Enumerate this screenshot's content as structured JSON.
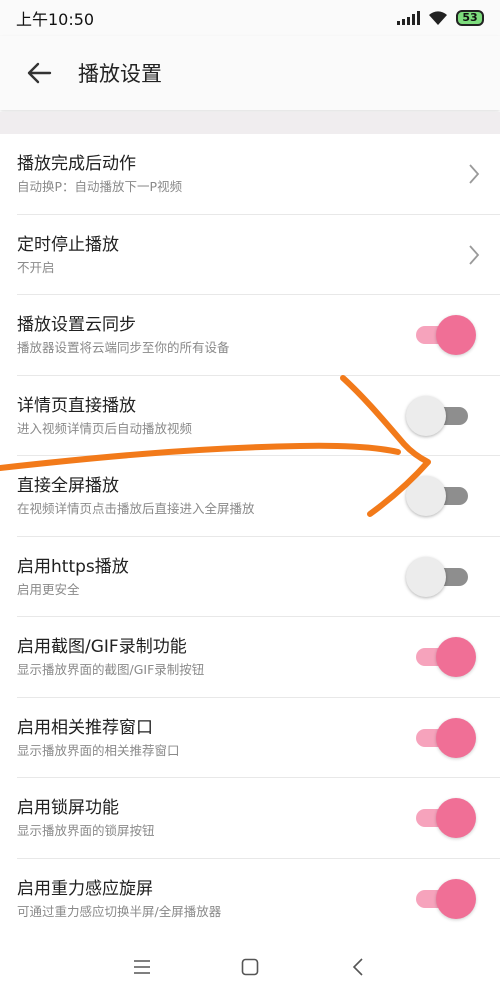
{
  "status_bar": {
    "time": "上午10:50",
    "battery": "53"
  },
  "app_bar": {
    "title": "播放设置",
    "back_icon": "arrow-left-icon"
  },
  "settings": [
    {
      "title": "播放完成后动作",
      "subtitle": "自动换P：自动播放下一P视频",
      "control": "chevron"
    },
    {
      "title": "定时停止播放",
      "subtitle": "不开启",
      "control": "chevron"
    },
    {
      "title": "播放设置云同步",
      "subtitle": "播放器设置将云端同步至你的所有设备",
      "control": "toggle",
      "on": true
    },
    {
      "title": "详情页直接播放",
      "subtitle": "进入视频详情页后自动播放视频",
      "control": "toggle",
      "on": false
    },
    {
      "title": "直接全屏播放",
      "subtitle": "在视频详情页点击播放后直接进入全屏播放",
      "control": "toggle",
      "on": false
    },
    {
      "title": "启用https播放",
      "subtitle": "启用更安全",
      "control": "toggle",
      "on": false
    },
    {
      "title": "启用截图/GIF录制功能",
      "subtitle": "显示播放界面的截图/GIF录制按钮",
      "control": "toggle",
      "on": true
    },
    {
      "title": "启用相关推荐窗口",
      "subtitle": "显示播放界面的相关推荐窗口",
      "control": "toggle",
      "on": true
    },
    {
      "title": "启用锁屏功能",
      "subtitle": "显示播放界面的锁屏按钮",
      "control": "toggle",
      "on": true
    },
    {
      "title": "启用重力感应旋屏",
      "subtitle": "可通过重力感应切换半屏/全屏播放器",
      "control": "toggle",
      "on": true
    }
  ],
  "nav_bar": {
    "items": [
      "menu-icon",
      "home-square-icon",
      "back-chevron-icon"
    ]
  },
  "colors": {
    "accent": "#f06f96",
    "accent_track": "#f6a3bc",
    "annotation_stroke": "#f27a1a"
  }
}
